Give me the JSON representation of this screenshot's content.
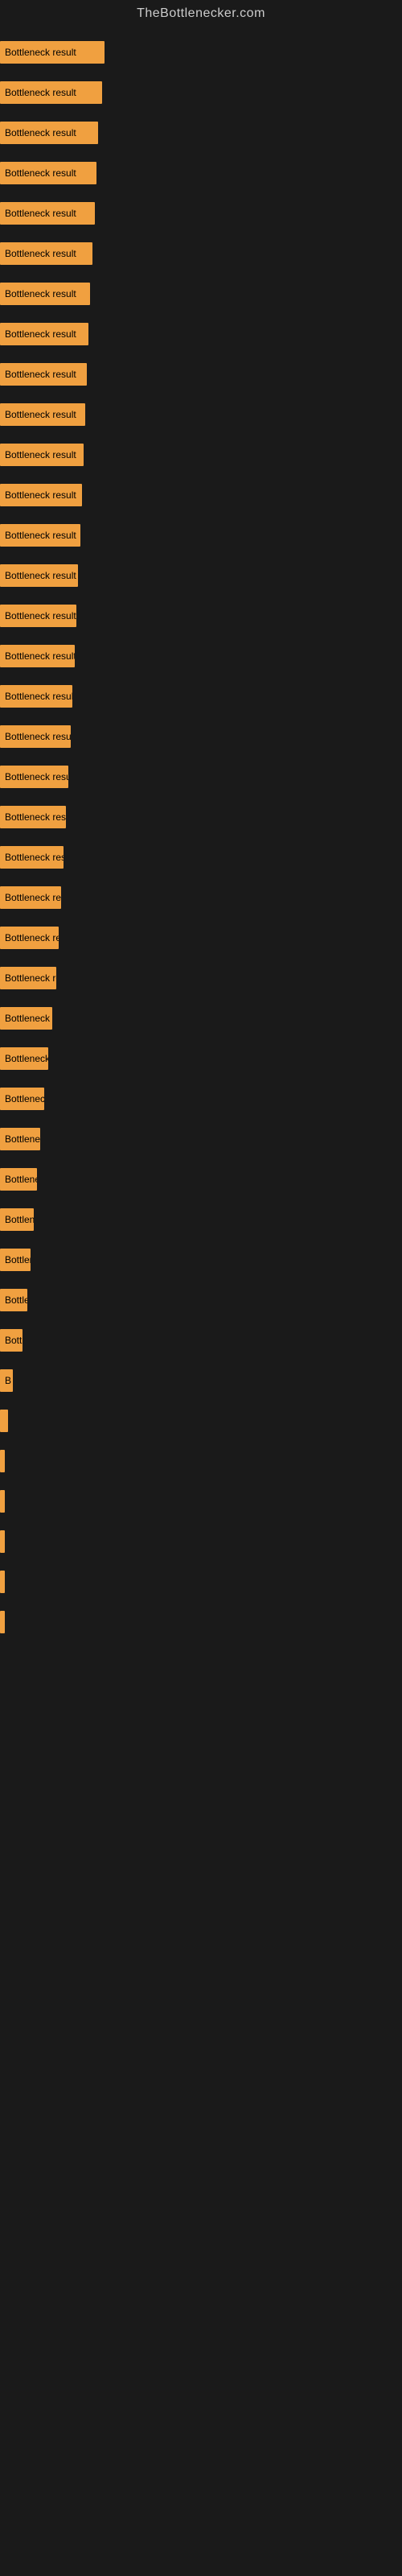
{
  "site": {
    "title": "TheBottlenecker.com"
  },
  "bars": [
    {
      "label": "Bottleneck result",
      "width": 130
    },
    {
      "label": "Bottleneck result",
      "width": 127
    },
    {
      "label": "Bottleneck result",
      "width": 122
    },
    {
      "label": "Bottleneck result",
      "width": 120
    },
    {
      "label": "Bottleneck result",
      "width": 118
    },
    {
      "label": "Bottleneck result",
      "width": 115
    },
    {
      "label": "Bottleneck result",
      "width": 112
    },
    {
      "label": "Bottleneck result",
      "width": 110
    },
    {
      "label": "Bottleneck result",
      "width": 108
    },
    {
      "label": "Bottleneck result",
      "width": 106
    },
    {
      "label": "Bottleneck result",
      "width": 104
    },
    {
      "label": "Bottleneck result",
      "width": 102
    },
    {
      "label": "Bottleneck result",
      "width": 100
    },
    {
      "label": "Bottleneck result",
      "width": 97
    },
    {
      "label": "Bottleneck result",
      "width": 95
    },
    {
      "label": "Bottleneck result",
      "width": 93
    },
    {
      "label": "Bottleneck result",
      "width": 90
    },
    {
      "label": "Bottleneck result",
      "width": 88
    },
    {
      "label": "Bottleneck result",
      "width": 85
    },
    {
      "label": "Bottleneck result",
      "width": 82
    },
    {
      "label": "Bottleneck result",
      "width": 79
    },
    {
      "label": "Bottleneck result",
      "width": 76
    },
    {
      "label": "Bottleneck result",
      "width": 73
    },
    {
      "label": "Bottleneck result",
      "width": 70
    },
    {
      "label": "Bottleneck result",
      "width": 65
    },
    {
      "label": "Bottleneck result",
      "width": 60
    },
    {
      "label": "Bottleneck result",
      "width": 55
    },
    {
      "label": "Bottleneck result",
      "width": 50
    },
    {
      "label": "Bottleneck result",
      "width": 46
    },
    {
      "label": "Bottleneck result",
      "width": 42
    },
    {
      "label": "Bottleneck result",
      "width": 38
    },
    {
      "label": "Bottleneck result",
      "width": 34
    },
    {
      "label": "Bottleneck result",
      "width": 28
    },
    {
      "label": "B",
      "width": 16
    },
    {
      "label": "",
      "width": 10
    },
    {
      "label": "",
      "width": 6
    },
    {
      "label": "",
      "width": 4
    },
    {
      "label": "",
      "width": 3
    },
    {
      "label": "",
      "width": 2
    },
    {
      "label": "",
      "width": 2
    }
  ]
}
